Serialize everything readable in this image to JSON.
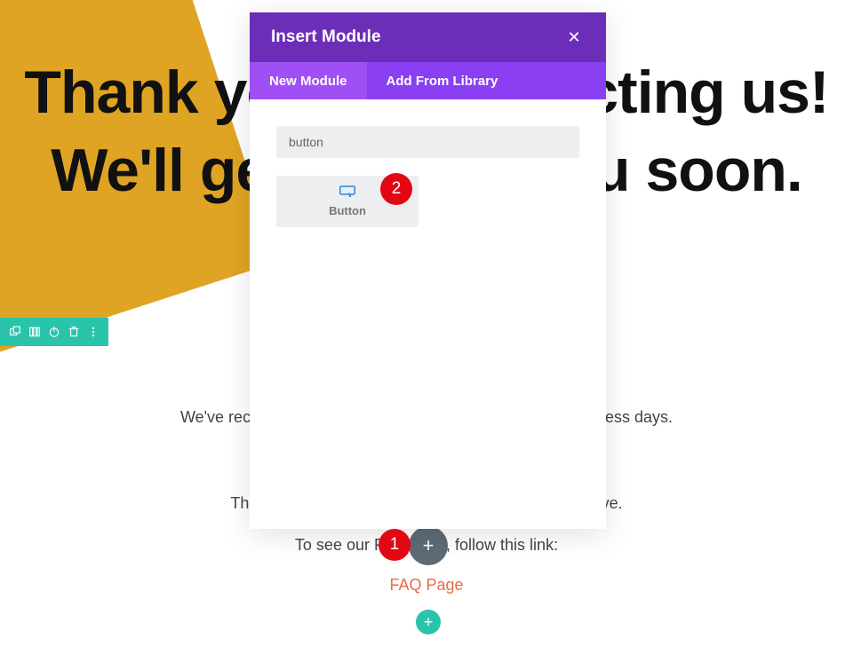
{
  "hero": {
    "line1": "Thank you for contacting us!",
    "line2": "We'll get back to you soon."
  },
  "body": {
    "line1": "We've received your inquiry. We'll answer you within 2 business days.",
    "line2": "This page can be the answer to any question you have.",
    "line3": "To see our FAQ page, follow this link:",
    "faq_link": "FAQ Page"
  },
  "modal": {
    "title": "Insert Module",
    "tabs": {
      "new": "New Module",
      "library": "Add From Library"
    },
    "search_value": "button",
    "module": {
      "label": "Button"
    }
  },
  "annotations": {
    "a1": "1",
    "a2": "2"
  }
}
